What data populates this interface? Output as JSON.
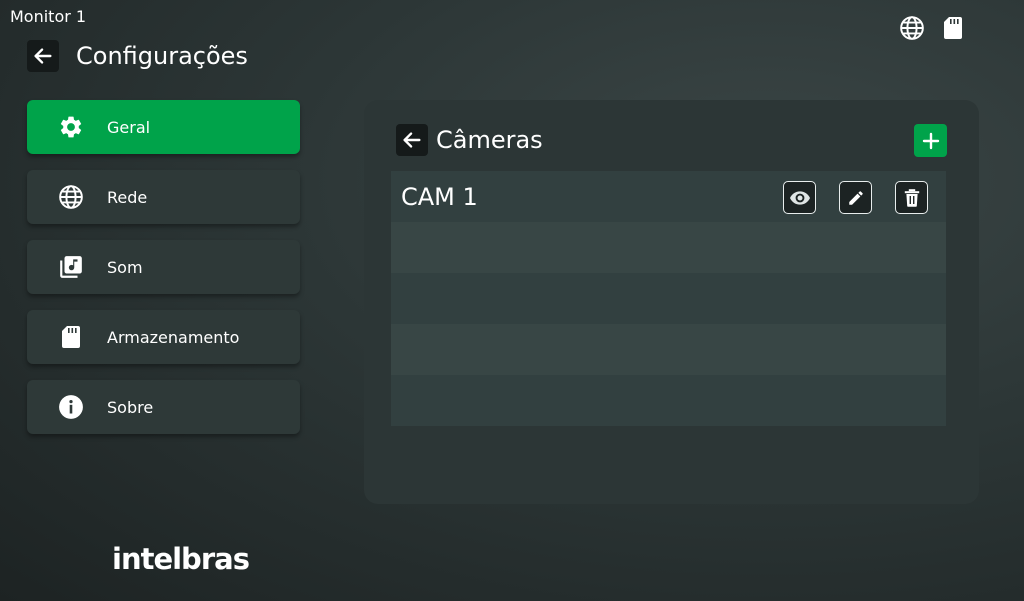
{
  "window": {
    "monitor_label": "Monitor 1"
  },
  "status_icons": [
    "globe-icon",
    "sd-card-icon"
  ],
  "header": {
    "title": "Configurações",
    "back_icon": "arrow-left-icon"
  },
  "sidebar": {
    "items": [
      {
        "label": "Geral",
        "icon": "gear-icon",
        "active": true
      },
      {
        "label": "Rede",
        "icon": "globe-icon",
        "active": false
      },
      {
        "label": "Som",
        "icon": "music-library-icon",
        "active": false
      },
      {
        "label": "Armazenamento",
        "icon": "sd-card-icon",
        "active": false
      },
      {
        "label": "Sobre",
        "icon": "info-icon",
        "active": false
      }
    ]
  },
  "panel": {
    "title": "Câmeras",
    "add_icon": "plus-icon",
    "rows": [
      {
        "name": "CAM 1",
        "actions": [
          "eye-icon",
          "pencil-icon",
          "trash-icon"
        ]
      },
      {
        "name": ""
      },
      {
        "name": ""
      },
      {
        "name": ""
      },
      {
        "name": ""
      }
    ]
  },
  "brand": {
    "logo_text": "intelbras"
  },
  "colors": {
    "accent": "#00a34a",
    "background": "#2c3636",
    "panel": "#2c3636",
    "row_odd": "#324040",
    "row_even": "#384645"
  }
}
